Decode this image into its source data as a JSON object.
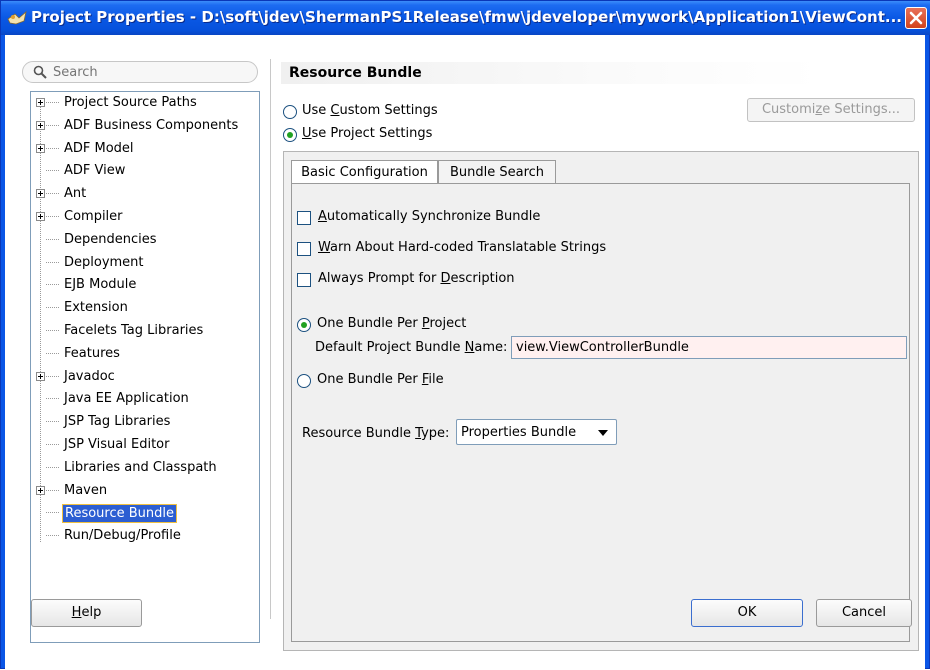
{
  "window": {
    "title": "Project Properties - D:\\soft\\jdev\\ShermanPS1Release\\fmw\\jdeveloper\\mywork\\Application1\\ViewCont..."
  },
  "search": {
    "placeholder": "Search"
  },
  "tree": {
    "items": [
      {
        "label": "Project Source Paths",
        "expandable": true
      },
      {
        "label": "ADF Business Components",
        "expandable": true
      },
      {
        "label": "ADF Model",
        "expandable": true
      },
      {
        "label": "ADF View",
        "expandable": false
      },
      {
        "label": "Ant",
        "expandable": true
      },
      {
        "label": "Compiler",
        "expandable": true
      },
      {
        "label": "Dependencies",
        "expandable": false
      },
      {
        "label": "Deployment",
        "expandable": false
      },
      {
        "label": "EJB Module",
        "expandable": false
      },
      {
        "label": "Extension",
        "expandable": false
      },
      {
        "label": "Facelets Tag Libraries",
        "expandable": false
      },
      {
        "label": "Features",
        "expandable": false
      },
      {
        "label": "Javadoc",
        "expandable": true
      },
      {
        "label": "Java EE Application",
        "expandable": false
      },
      {
        "label": "JSP Tag Libraries",
        "expandable": false
      },
      {
        "label": "JSP Visual Editor",
        "expandable": false
      },
      {
        "label": "Libraries and Classpath",
        "expandable": false
      },
      {
        "label": "Maven",
        "expandable": true
      },
      {
        "label": "Resource Bundle",
        "expandable": false,
        "selected": true
      },
      {
        "label": "Run/Debug/Profile",
        "expandable": false
      }
    ]
  },
  "panel": {
    "heading": "Resource Bundle",
    "use_custom_pre": "Use ",
    "use_custom_mn": "C",
    "use_custom_post": "ustom Settings",
    "use_project_pre": "",
    "use_project_mn": "U",
    "use_project_post": "se Project Settings",
    "customize_pre": "Customi",
    "customize_mn": "z",
    "customize_post": "e Settings...",
    "tabs": [
      "Basic Configuration",
      "Bundle Search"
    ],
    "auto_sync_mn": "A",
    "auto_sync_post": "utomatically Synchronize Bundle",
    "warn_mn": "W",
    "warn_post": "arn About Hard-coded Translatable Strings",
    "always_pre": "Always Prompt for ",
    "always_mn": "D",
    "always_post": "escription",
    "one_per_project_pre": "One Bundle Per ",
    "one_per_project_mn": "P",
    "one_per_project_post": "roject",
    "default_name_pre": "Default Project Bundle ",
    "default_name_mn": "N",
    "default_name_post": "ame:",
    "default_name_value": "view.ViewControllerBundle",
    "one_per_file_pre": "One Bundle Per ",
    "one_per_file_mn": "F",
    "one_per_file_post": "ile",
    "bundle_type_pre": "Resource Bundle ",
    "bundle_type_mn": "T",
    "bundle_type_post": "ype:",
    "bundle_type_value": "Properties Bundle"
  },
  "buttons": {
    "help_mn": "H",
    "help_post": "elp",
    "ok": "OK",
    "cancel": "Cancel"
  },
  "colors": {
    "titlebar": "#0a58e4",
    "close": "#d2431c",
    "selection": "#2c5ed2",
    "radio_dot": "#21a121"
  }
}
